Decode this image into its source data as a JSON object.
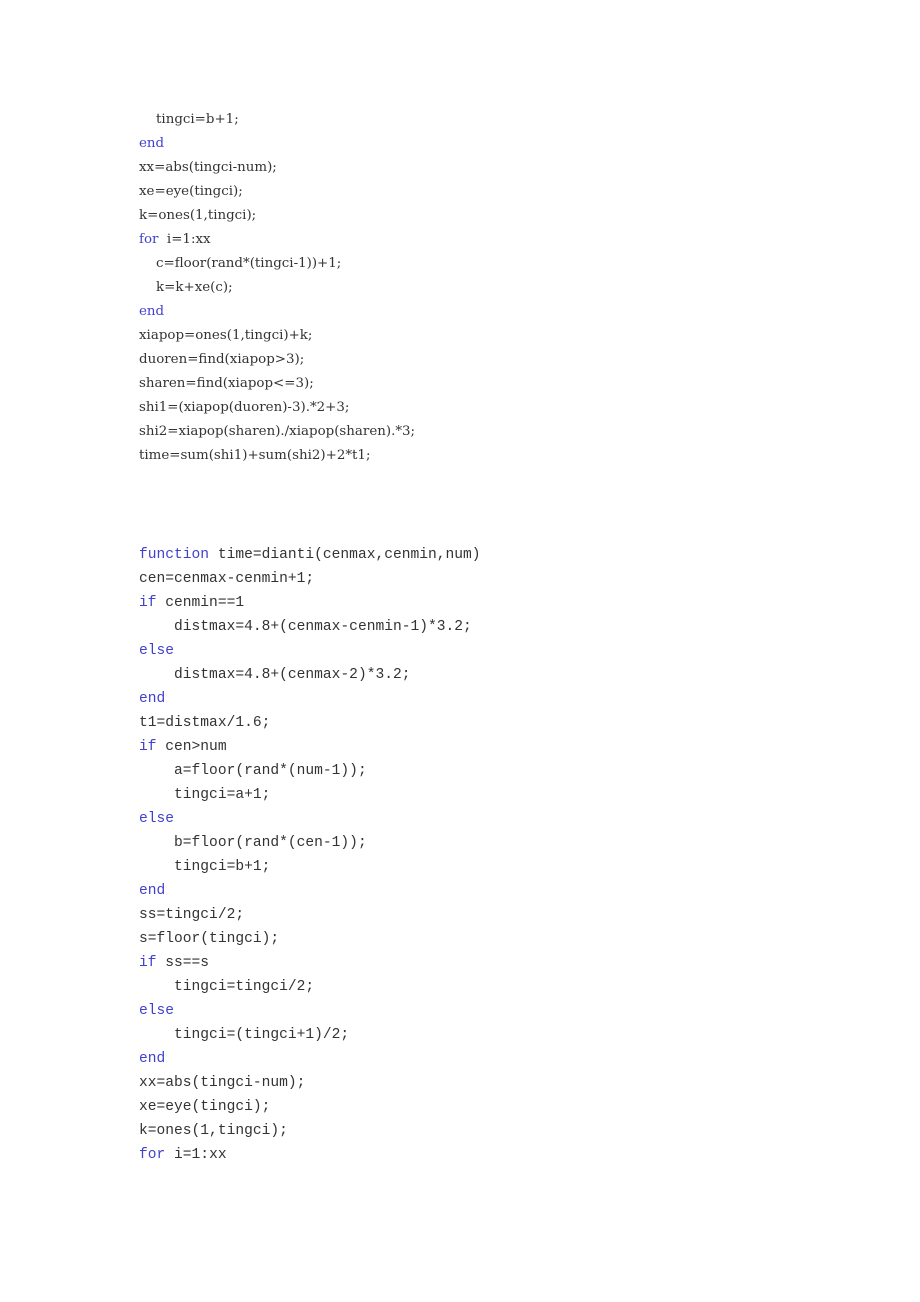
{
  "document": {
    "kind": "matlab-code-listing",
    "page_background": "#ffffff",
    "text_color": "#333333",
    "keyword_color": "#4141cc"
  },
  "blocks": [
    {
      "id": "block-1",
      "name": "code-block-continuation",
      "lines": [
        {
          "keyword": "",
          "rest": "    tingci=b+1;"
        },
        {
          "keyword": "end",
          "rest": ""
        },
        {
          "keyword": "",
          "rest": "xx=abs(tingci-num);"
        },
        {
          "keyword": "",
          "rest": "xe=eye(tingci);"
        },
        {
          "keyword": "",
          "rest": "k=ones(1,tingci);"
        },
        {
          "keyword": "for",
          "rest": "  i=1:xx"
        },
        {
          "keyword": "",
          "rest": "    c=floor(rand*(tingci-1))+1;"
        },
        {
          "keyword": "",
          "rest": "    k=k+xe(c);"
        },
        {
          "keyword": "end",
          "rest": ""
        },
        {
          "keyword": "",
          "rest": "xiapop=ones(1,tingci)+k;"
        },
        {
          "keyword": "",
          "rest": "duoren=find(xiapop>3);"
        },
        {
          "keyword": "",
          "rest": "sharen=find(xiapop<=3);"
        },
        {
          "keyword": "",
          "rest": "shi1=(xiapop(duoren)-3).*2+3;"
        },
        {
          "keyword": "",
          "rest": "shi2=xiapop(sharen)./xiapop(sharen).*3;"
        },
        {
          "keyword": "",
          "rest": "time=sum(shi1)+sum(shi2)+2*t1;"
        }
      ]
    },
    {
      "id": "block-2",
      "name": "code-block-function-dianti",
      "lines": [
        {
          "keyword": "function",
          "rest": " time=dianti(cenmax,cenmin,num)"
        },
        {
          "keyword": "",
          "rest": "cen=cenmax-cenmin+1;"
        },
        {
          "keyword": "if",
          "rest": " cenmin==1"
        },
        {
          "keyword": "",
          "rest": "    distmax=4.8+(cenmax-cenmin-1)*3.2;"
        },
        {
          "keyword": "else",
          "rest": ""
        },
        {
          "keyword": "",
          "rest": "    distmax=4.8+(cenmax-2)*3.2;"
        },
        {
          "keyword": "end",
          "rest": ""
        },
        {
          "keyword": "",
          "rest": "t1=distmax/1.6;"
        },
        {
          "keyword": "if",
          "rest": " cen>num"
        },
        {
          "keyword": "",
          "rest": "    a=floor(rand*(num-1));"
        },
        {
          "keyword": "",
          "rest": "    tingci=a+1;"
        },
        {
          "keyword": "else",
          "rest": ""
        },
        {
          "keyword": "",
          "rest": "    b=floor(rand*(cen-1));"
        },
        {
          "keyword": "",
          "rest": "    tingci=b+1;"
        },
        {
          "keyword": "end",
          "rest": ""
        },
        {
          "keyword": "",
          "rest": "ss=tingci/2;"
        },
        {
          "keyword": "",
          "rest": "s=floor(tingci);"
        },
        {
          "keyword": "if",
          "rest": " ss==s"
        },
        {
          "keyword": "",
          "rest": "    tingci=tingci/2;"
        },
        {
          "keyword": "else",
          "rest": ""
        },
        {
          "keyword": "",
          "rest": "    tingci=(tingci+1)/2;"
        },
        {
          "keyword": "end",
          "rest": ""
        },
        {
          "keyword": "",
          "rest": "xx=abs(tingci-num);"
        },
        {
          "keyword": "",
          "rest": "xe=eye(tingci);"
        },
        {
          "keyword": "",
          "rest": "k=ones(1,tingci);"
        },
        {
          "keyword": "for",
          "rest": " i=1:xx"
        }
      ]
    }
  ]
}
